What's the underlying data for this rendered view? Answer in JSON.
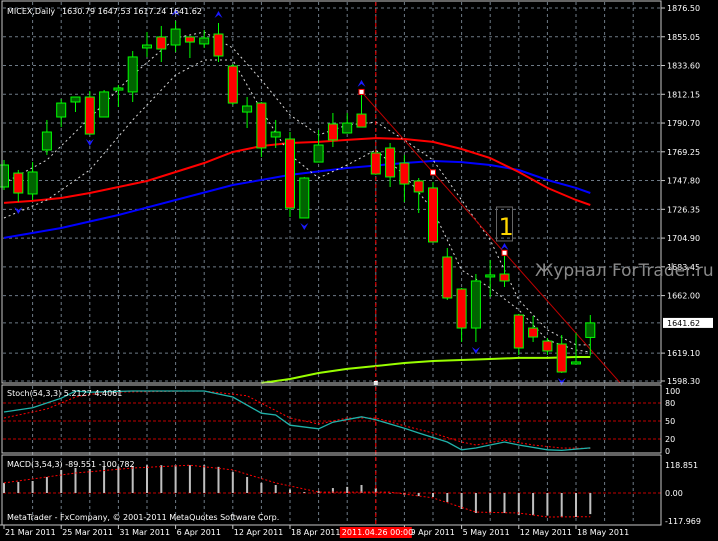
{
  "window": {
    "title": "MICEX,Daily",
    "ohlc_readout": "1630.79 1647.53 1617.24 1641.62"
  },
  "watermark": "Журнал ForTrader.ru",
  "copyright": "MetaTrader - FxCompany, © 2001-2011 MetaQuotes Software Corp.",
  "colors": {
    "background": "#000000",
    "grid": "#6e7a86",
    "up_body": "#006400",
    "down_body": "#ff0000",
    "candle_outline": "#00ff00",
    "ma_red": "#ff0000",
    "ma_blue": "#0000ff",
    "ma_lime": "#99ff00",
    "dotted": "#d8d8d8",
    "fractal": "#1a1aff",
    "stoch_main": "#20b2aa",
    "stoch_signal": "#ff0000",
    "level": "#c00000",
    "macd_hist": "#c0c0c0",
    "annotation": "#ffd700"
  },
  "chart_data": {
    "type": "candlestick",
    "title": "MICEX,Daily",
    "ylim": [
      1598.3,
      1876.5
    ],
    "y_ticks": [
      1876.5,
      1855.05,
      1833.6,
      1812.15,
      1790.7,
      1769.25,
      1747.8,
      1726.35,
      1704.9,
      1683.45,
      1662.0,
      1619.1,
      1598.3
    ],
    "y_tick_labels": [
      "1876.50",
      "1855.05",
      "1833.60",
      "1812.15",
      "1790.70",
      "1769.25",
      "1747.80",
      "1726.35",
      "1704.90",
      "1683.45",
      "1662.00",
      "1619.10",
      "1598.30"
    ],
    "current_price": 1641.62,
    "current_price_label": "1641.62",
    "x_labels": [
      {
        "bar": 0,
        "text": "21 Mar 2011"
      },
      {
        "bar": 4,
        "text": "25 Mar 2011"
      },
      {
        "bar": 8,
        "text": "31 Mar 2011"
      },
      {
        "bar": 12,
        "text": "6 Apr 2011"
      },
      {
        "bar": 16,
        "text": "12 Apr 2011"
      },
      {
        "bar": 20,
        "text": "18 Apr 2011"
      },
      {
        "bar": 28,
        "text": "29 Apr 2011"
      },
      {
        "bar": 32,
        "text": "5 May 2011"
      },
      {
        "bar": 36,
        "text": "12 May 2011"
      },
      {
        "bar": 40,
        "text": "18 May 2011"
      }
    ],
    "cursor": {
      "bar": 26,
      "label": "2011.04.26 00:00"
    },
    "candles_ohlc": [
      [
        1743.0,
        1763.1,
        1740.8,
        1759.4
      ],
      [
        1753.4,
        1755.7,
        1731.8,
        1738.5
      ],
      [
        1737.8,
        1761.6,
        1733.3,
        1754.2
      ],
      [
        1770.6,
        1793.0,
        1766.9,
        1784.0
      ],
      [
        1795.2,
        1808.6,
        1787.7,
        1805.6
      ],
      [
        1806.4,
        1810.1,
        1798.9,
        1810.1
      ],
      [
        1810.1,
        1814.6,
        1782.5,
        1782.5
      ],
      [
        1795.2,
        1815.3,
        1795.2,
        1813.9
      ],
      [
        1815.3,
        1819.1,
        1802.7,
        1816.8
      ],
      [
        1813.9,
        1844.4,
        1806.4,
        1840.0
      ],
      [
        1846.7,
        1858.6,
        1840.0,
        1848.9
      ],
      [
        1854.9,
        1863.1,
        1836.2,
        1845.9
      ],
      [
        1848.9,
        1866.8,
        1843.7,
        1860.8
      ],
      [
        1854.9,
        1854.9,
        1839.2,
        1851.1
      ],
      [
        1849.7,
        1860.1,
        1846.7,
        1854.1
      ],
      [
        1857.1,
        1865.3,
        1836.2,
        1840.7
      ],
      [
        1833.2,
        1834.7,
        1804.2,
        1805.6
      ],
      [
        1798.9,
        1810.1,
        1787.0,
        1803.4
      ],
      [
        1805.6,
        1806.4,
        1765.4,
        1772.1
      ],
      [
        1780.3,
        1793.0,
        1772.1,
        1784.0
      ],
      [
        1778.8,
        1784.0,
        1720.6,
        1727.3
      ],
      [
        1719.9,
        1750.5,
        1719.9,
        1749.7
      ],
      [
        1761.6,
        1785.5,
        1761.6,
        1774.3
      ],
      [
        1790.0,
        1798.2,
        1772.8,
        1778.1
      ],
      [
        1783.3,
        1798.2,
        1783.3,
        1790.7
      ],
      [
        1797.4,
        1813.9,
        1787.7,
        1787.7
      ],
      [
        1768.4,
        1770.6,
        1752.0,
        1752.7
      ],
      [
        1772.1,
        1775.8,
        1743.0,
        1750.5
      ],
      [
        1760.9,
        1766.9,
        1731.8,
        1745.2
      ],
      [
        1747.5,
        1749.7,
        1723.6,
        1739.3
      ],
      [
        1742.3,
        1746.7,
        1702.0,
        1702.0
      ],
      [
        1690.8,
        1697.5,
        1658.7,
        1660.2
      ],
      [
        1666.9,
        1667.7,
        1627.4,
        1637.8
      ],
      [
        1637.8,
        1678.1,
        1627.4,
        1672.9
      ],
      [
        1675.9,
        1688.6,
        1661.0,
        1677.4
      ],
      [
        1678.1,
        1692.3,
        1668.4,
        1672.9
      ],
      [
        1647.5,
        1648.3,
        1617.7,
        1622.9
      ],
      [
        1637.8,
        1646.8,
        1627.4,
        1631.1
      ],
      [
        1628.1,
        1630.4,
        1617.7,
        1620.7
      ],
      [
        1625.9,
        1632.6,
        1604.3,
        1605.0
      ],
      [
        1611.0,
        1634.1,
        1611.0,
        1612.5
      ],
      [
        1630.79,
        1647.53,
        1617.24,
        1641.62
      ]
    ],
    "ma_red": [
      [
        0,
        1731.1
      ],
      [
        2,
        1732.6
      ],
      [
        4,
        1734.8
      ],
      [
        6,
        1738.5
      ],
      [
        8,
        1743.0
      ],
      [
        10,
        1747.5
      ],
      [
        12,
        1754.2
      ],
      [
        14,
        1760.9
      ],
      [
        16,
        1769.1
      ],
      [
        18,
        1773.6
      ],
      [
        20,
        1775.8
      ],
      [
        22,
        1776.6
      ],
      [
        24,
        1778.1
      ],
      [
        26,
        1779.5
      ],
      [
        28,
        1778.8
      ],
      [
        30,
        1776.6
      ],
      [
        32,
        1771.3
      ],
      [
        34,
        1764.6
      ],
      [
        36,
        1754.2
      ],
      [
        38,
        1742.3
      ],
      [
        40,
        1733.3
      ],
      [
        41,
        1729.6
      ]
    ],
    "ma_blue": [
      [
        0,
        1705.0
      ],
      [
        4,
        1712.4
      ],
      [
        8,
        1722.1
      ],
      [
        12,
        1733.3
      ],
      [
        16,
        1744.5
      ],
      [
        20,
        1752.0
      ],
      [
        24,
        1757.2
      ],
      [
        28,
        1760.9
      ],
      [
        30,
        1762.4
      ],
      [
        32,
        1761.6
      ],
      [
        34,
        1759.4
      ],
      [
        36,
        1755.7
      ],
      [
        38,
        1748.2
      ],
      [
        40,
        1742.3
      ],
      [
        41,
        1738.5
      ]
    ],
    "ma_lime": [
      [
        18,
        1596.8
      ],
      [
        20,
        1599.8
      ],
      [
        22,
        1604.3
      ],
      [
        24,
        1607.3
      ],
      [
        26,
        1609.5
      ],
      [
        28,
        1611.7
      ],
      [
        30,
        1613.2
      ],
      [
        32,
        1614.0
      ],
      [
        34,
        1614.7
      ],
      [
        36,
        1615.5
      ],
      [
        38,
        1615.5
      ],
      [
        40,
        1616.2
      ],
      [
        41,
        1616.2
      ]
    ],
    "dotted_upper": [
      [
        0,
        1746.0
      ],
      [
        3,
        1763.1
      ],
      [
        6,
        1794.5
      ],
      [
        9,
        1826.5
      ],
      [
        12,
        1854.1
      ],
      [
        14,
        1858.6
      ],
      [
        16,
        1846.7
      ],
      [
        18,
        1822.8
      ],
      [
        20,
        1796.7
      ],
      [
        22,
        1781.8
      ],
      [
        24,
        1789.2
      ],
      [
        26,
        1791.5
      ],
      [
        28,
        1778.1
      ],
      [
        30,
        1763.1
      ],
      [
        32,
        1733.3
      ],
      [
        34,
        1703.5
      ],
      [
        36,
        1658.7
      ],
      [
        38,
        1636.4
      ],
      [
        40,
        1625.2
      ],
      [
        41,
        1625.2
      ]
    ],
    "dotted_lower": [
      [
        0,
        1719.9
      ],
      [
        3,
        1733.3
      ],
      [
        6,
        1755.7
      ],
      [
        9,
        1793.0
      ],
      [
        12,
        1826.5
      ],
      [
        14,
        1837.7
      ],
      [
        16,
        1837.7
      ],
      [
        18,
        1800.4
      ],
      [
        20,
        1766.9
      ],
      [
        22,
        1749.7
      ],
      [
        24,
        1759.4
      ],
      [
        26,
        1770.6
      ],
      [
        28,
        1752.0
      ],
      [
        30,
        1725.8
      ],
      [
        32,
        1681.1
      ],
      [
        34,
        1667.7
      ],
      [
        36,
        1651.3
      ],
      [
        38,
        1628.9
      ],
      [
        40,
        1621.4
      ],
      [
        41,
        1619.9
      ]
    ],
    "trendline": [
      [
        25,
        1813.9
      ],
      [
        43.1,
        1596.8
      ]
    ],
    "trend_markers": [
      [
        25,
        1813.9
      ],
      [
        30,
        1753.9
      ],
      [
        35,
        1693.9
      ]
    ],
    "fractals_up": [
      12,
      15,
      25,
      35
    ],
    "fractals_down": [
      1,
      6,
      21,
      33,
      39
    ],
    "annotation": {
      "bar": 35,
      "text": "1"
    },
    "stochastic": {
      "label": "Stoch(54,3,3) 5.2127 4.4061",
      "ylim": [
        0,
        100
      ],
      "levels": [
        100,
        80,
        50,
        20,
        0
      ],
      "level_labels": [
        "100",
        "80",
        "50",
        "20",
        "0"
      ],
      "main": [
        [
          0,
          65
        ],
        [
          2,
          72
        ],
        [
          4,
          88
        ],
        [
          5,
          100
        ],
        [
          6,
          98
        ],
        [
          9,
          100
        ],
        [
          14,
          100
        ],
        [
          16,
          90
        ],
        [
          18,
          63
        ],
        [
          19,
          60
        ],
        [
          20,
          43
        ],
        [
          22,
          37
        ],
        [
          23,
          48
        ],
        [
          25,
          57
        ],
        [
          26,
          52
        ],
        [
          28,
          38
        ],
        [
          29,
          30
        ],
        [
          31,
          15
        ],
        [
          32,
          2
        ],
        [
          33,
          5
        ],
        [
          35,
          15
        ],
        [
          36,
          10
        ],
        [
          38,
          2
        ],
        [
          39,
          1
        ],
        [
          41,
          5.2127
        ]
      ],
      "signal": [
        [
          0,
          55
        ],
        [
          3,
          70
        ],
        [
          5,
          90
        ],
        [
          7,
          98
        ],
        [
          14,
          100
        ],
        [
          17,
          92
        ],
        [
          20,
          55
        ],
        [
          22,
          45
        ],
        [
          24,
          55
        ],
        [
          26,
          55
        ],
        [
          28,
          42
        ],
        [
          30,
          30
        ],
        [
          32,
          15
        ],
        [
          33,
          10
        ],
        [
          35,
          18
        ],
        [
          37,
          10
        ],
        [
          39,
          5
        ],
        [
          41,
          4.4061
        ]
      ]
    },
    "macd": {
      "label": "MACD(3,54,3) -89.551 -100.782",
      "ylim": [
        -117.969,
        118.851
      ],
      "tick_values": [
        118.851,
        0,
        -117.969
      ],
      "tick_labels": [
        "118.851",
        "0.00",
        "-117.969"
      ],
      "histogram": [
        43,
        47,
        51,
        68,
        98,
        106,
        102,
        111,
        111,
        115,
        118,
        118,
        118,
        118,
        118,
        111,
        89,
        68,
        43,
        34,
        15,
        4,
        8,
        21,
        26,
        34,
        21,
        0,
        -8,
        -13,
        -17,
        -38,
        -68,
        -85,
        -85,
        -85,
        -94,
        -94,
        -96,
        -102,
        -102,
        -89.551
      ],
      "signal": [
        [
          0,
          43
        ],
        [
          5,
          85
        ],
        [
          9,
          106
        ],
        [
          13,
          118
        ],
        [
          16,
          98
        ],
        [
          19,
          43
        ],
        [
          22,
          4
        ],
        [
          27,
          4
        ],
        [
          30,
          -21
        ],
        [
          33,
          -81
        ],
        [
          36,
          -85
        ],
        [
          38,
          -102
        ],
        [
          41,
          -100.782
        ]
      ]
    }
  }
}
